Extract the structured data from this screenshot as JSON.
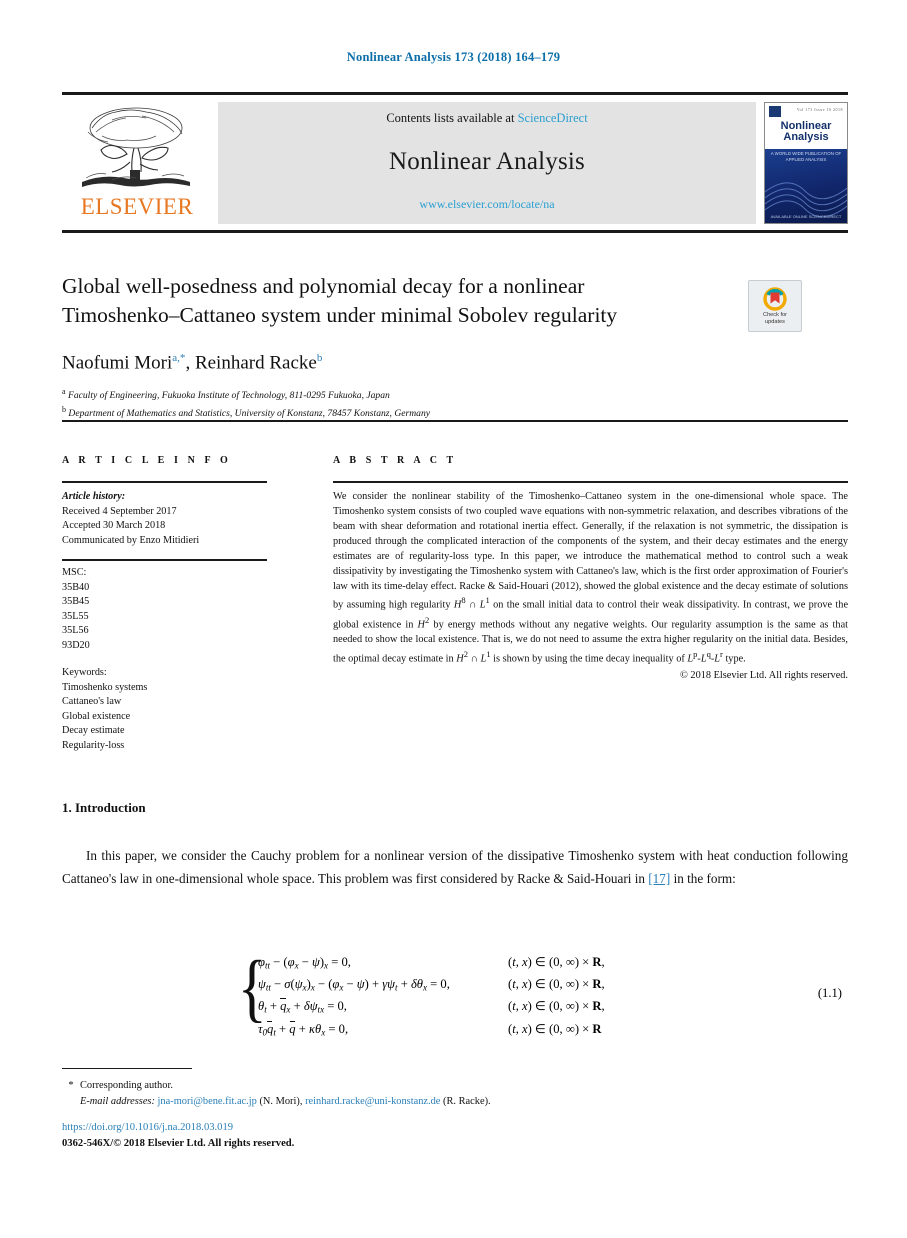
{
  "running_head": "Nonlinear Analysis 173 (2018) 164–179",
  "masthead": {
    "publisher": "ELSEVIER",
    "contents_prefix": "Contents lists available at ",
    "contents_link": "ScienceDirect",
    "journal_name": "Nonlinear Analysis",
    "journal_url": "www.elsevier.com/locate/na",
    "cover": {
      "title_line1": "Nonlinear",
      "title_line2": "Analysis",
      "top_text": "Vol 173    Issue    10 2018",
      "sub_text": "A WORLD WIDE\nPUBLICATION\nOF APPLIED ANALYSIS",
      "foot_text": "AVAILABLE ONLINE\nSCIENCEDIRECT"
    }
  },
  "article": {
    "title_line1": "Global well-posedness and polynomial decay for a nonlinear",
    "title_line2": "Timoshenko–Cattaneo system under minimal Sobolev regularity",
    "crossmark_label_line1": "Check for",
    "crossmark_label_line2": "updates",
    "authors": "Naofumi Mori",
    "author1_sup": "a,*",
    "authors_second": ", Reinhard Racke",
    "author2_sup": "b",
    "affiliations": [
      {
        "marker": "a",
        "text": "Faculty of Engineering, Fukuoka Institute of Technology, 811-0295 Fukuoka, Japan"
      },
      {
        "marker": "b",
        "text": "Department of Mathematics and Statistics, University of Konstanz, 78457 Konstanz, Germany"
      }
    ]
  },
  "info": {
    "heading": "A R T I C L E   I N F O",
    "history_label": "Article history:",
    "history": [
      "Received 4 September 2017",
      "Accepted 30 March 2018",
      "Communicated by Enzo Mitidieri"
    ],
    "msc_label": "MSC:",
    "msc": [
      "35B40",
      "35B45",
      "35L55",
      "35L56",
      "93D20"
    ],
    "keywords_label": "Keywords:",
    "keywords": [
      "Timoshenko systems",
      "Cattaneo's law",
      "Global existence",
      "Decay estimate",
      "Regularity-loss"
    ]
  },
  "abstract": {
    "heading": "A B S T R A C T",
    "p1": "We consider the nonlinear stability of the Timoshenko–Cattaneo system in the one-dimensional whole space. The Timoshenko system consists of two coupled wave equations with non-symmetric relaxation, and describes vibrations of the beam with shear deformation and rotational inertia effect. Generally, if the relaxation is not symmetric, the dissipation is produced through the complicated interaction of the components of the system, and their decay estimates and the energy estimates are of regularity-loss type. In this paper, we introduce the mathematical method to control such a weak dissipativity by investigating the Timoshenko system with Cattaneo's law, which is the first order approximation of Fourier's law with its time-delay effect. Racke & Said-Houari (2012), showed the global existence and the decay estimate of solutions by assuming high regularity ",
    "math1": "H",
    "math1_sup": "8",
    "math1_cap": " ∩ ",
    "math1b": "L",
    "math1b_sup": "1",
    "p2": " on the small initial data to control their weak dissipativity. In contrast, we prove the global existence in ",
    "math2": "H",
    "math2_sup": "2",
    "p3": " by energy methods without any negative weights. Our regularity assumption is the same as that needed to show the local existence. That is, we do not need to assume the extra higher regularity on the initial data. Besides, the optimal decay estimate in ",
    "math3": "H",
    "math3_sup": "2",
    "math3_cap": " ∩ ",
    "math3b": "L",
    "math3b_sup": "1",
    "p4": " is shown by using the time decay inequality of ",
    "math4": "L",
    "math4_sup": "p",
    "math4_mid": "-L",
    "math4_sup2": "q",
    "math4_mid2": "-L",
    "math4_sup3": "r",
    "p5": " type.",
    "copyright": "© 2018 Elsevier Ltd. All rights reserved."
  },
  "section": {
    "number_title": "1. Introduction",
    "paragraph_a": "In this paper, we consider the Cauchy problem for a nonlinear version of the dissipative Timoshenko system with heat conduction following Cattaneo's law in one-dimensional whole space. This problem was first considered by Racke & Said-Houari in ",
    "reference": "[17]",
    "paragraph_b": " in the form:"
  },
  "equations": {
    "number": "(1.1)",
    "rows": [
      {
        "left": "φtt − (φx − ψ)x = 0,",
        "right": "(t, x) ∈ (0, ∞) × R,"
      },
      {
        "left": "ψtt − σ(ψx)x − (φx − ψ) + γψt + δθx = 0,",
        "right": "(t, x) ∈ (0, ∞) × R,"
      },
      {
        "left": "θt + q̄x + δψtx = 0,",
        "right": "(t, x) ∈ (0, ∞) × R,"
      },
      {
        "left": "τ0q̄t + q̄ + κθx = 0,",
        "right": "(t, x) ∈ (0, ∞) × R"
      }
    ]
  },
  "footnotes": {
    "corresponding": "Corresponding author.",
    "email_label": "E-mail addresses:",
    "email1": "jna-mori@bene.fit.ac.jp",
    "email1_owner": "(N. Mori),",
    "email2": "reinhard.racke@uni-konstanz.de",
    "email2_owner": "(R. Racke).",
    "doi": "https://doi.org/10.1016/j.na.2018.03.019",
    "issn": "0362-546X/© 2018 Elsevier Ltd. All rights reserved."
  },
  "colors": {
    "link_blue": "#2a7fb8",
    "header_blue": "#0b6ea8",
    "elsevier_orange": "#e87722",
    "cover_navy": "#13306b"
  }
}
